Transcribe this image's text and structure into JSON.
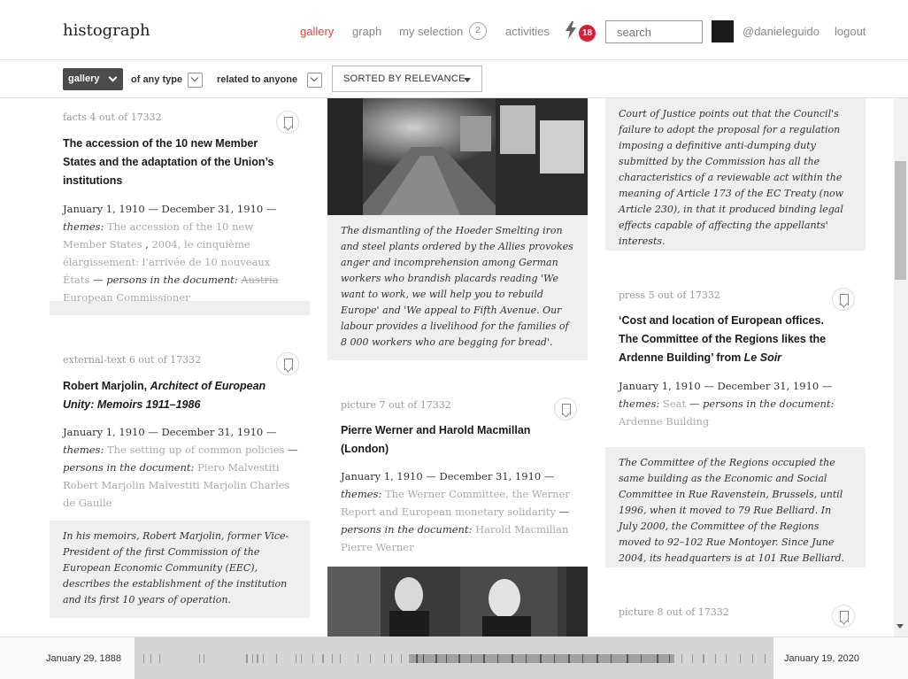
{
  "header": {
    "brand": "histograph",
    "nav": {
      "gallery": "gallery",
      "graph": "graph",
      "my_selection": "my selection",
      "selection_count": "2",
      "activities": "activities",
      "notifications": "18"
    },
    "search_placeholder": "search",
    "username": "@danieleguido",
    "logout": "logout"
  },
  "filters": {
    "view": "gallery",
    "type_filter": "of any type",
    "related_filter": "related to anyone",
    "sort": "SORTED BY RELEVANCE"
  },
  "cards": {
    "c1": {
      "meta": "facts 4 out of 17332",
      "title": "The accession of the 10 new Member States and the adaptation of the Union’s institutions",
      "dates": "January 1, 1910 — December 31, 1910 —",
      "themes_label": "themes:",
      "themes": [
        "The accession of the 10 new Member States",
        "2004, le cinquième élargissement: l’arrivée de 10 nouveaux États"
      ],
      "persons_label": "— persons in the document:",
      "persons": [
        "Austria",
        "European Commissioner"
      ]
    },
    "c2": {
      "meta": "external-text 6 out of 17332",
      "title_bold": "Robert Marjolin, ",
      "title_italic": "Architect of European Unity: Memoirs 1911–1986",
      "dates": "January 1, 1910 — December 31, 1910 —",
      "themes_label": "themes:",
      "themes": [
        "The setting up of common policies"
      ],
      "persons_label": "— persons in the document:",
      "persons": [
        "Piero Malvestiti",
        "Robert Marjolin",
        "Malvestiti",
        "Marjolin",
        "Charles de Gaulle"
      ],
      "excerpt": "In his memoirs, Robert Marjolin, former Vice-President of the first Commission of the European Economic Community (EEC), describes the establishment of the institution and its first 10 years of operation."
    },
    "c3": {
      "excerpt": "The dismantling of the Hoeder Smelting iron and steel plants ordered by the Allies provokes anger and incomprehension among German workers who brandish placards reading 'We want to work, we will help you to rebuild Europe' and 'We appeal to Fifth Avenue. Our labour provides a livelihood for the families of 8 000 workers who are begging for bread'."
    },
    "c4": {
      "meta": "picture 7 out of 17332",
      "title": "Pierre Werner and Harold Macmillan (London)",
      "dates": "January 1, 1910 — December 31, 1910 —",
      "themes_label": "themes:",
      "themes": [
        "The Werner Committee, the Werner Report and European monetary solidarity"
      ],
      "persons_label": "— persons in the document:",
      "persons": [
        "Harold Macmillan",
        "Pierre Werner"
      ]
    },
    "c5": {
      "excerpt": "Court of Justice points out that the Council's failure to adopt the proposal for a regulation imposing a definitive anti-dumping duty submitted by the Commission has all the characteristics of a reviewable act within the meaning of Article 173 of the EC Treaty (now Article 230), in that it produced binding legal effects capable of affecting the appellants' interests."
    },
    "c6": {
      "meta": "press 5 out of 17332",
      "title_bold": "‘Cost and location of European offices. The Committee of the Regions likes the Ardenne Building’ from ",
      "title_italic": "Le Soir",
      "dates": "January 1, 1910 — December 31, 1910 —",
      "themes_label": "themes:",
      "themes": [
        "Seat"
      ],
      "persons_label": "— persons in the document:",
      "persons": [
        "Ardenne Building"
      ],
      "excerpt": "The Committee of the Regions occupied the same building as the Economic and Social Committee in Rue Ravenstein, Brussels, until 1996, when it moved to 79 Rue Belliard. In July 2000, the Committee of the Regions moved to 92–102 Rue Montoyer. Since June 2004, its headquarters is at 101 Rue Belliard."
    },
    "c7": {
      "meta": "picture 8 out of 17332"
    }
  },
  "timeline": {
    "start": "January 29, 1888",
    "end": "January 19, 2020"
  },
  "colors": {
    "accent": "#e0453a",
    "badge": "#d3203a",
    "button_dark": "#4c4c4c",
    "excerpt_bg": "#efefef",
    "tag_text": "#aaaaaa"
  },
  "icons": {
    "activity": "lightning-bolt-icon",
    "bookmark": "bookmark-icon",
    "dropdown": "chevron-down-icon"
  }
}
